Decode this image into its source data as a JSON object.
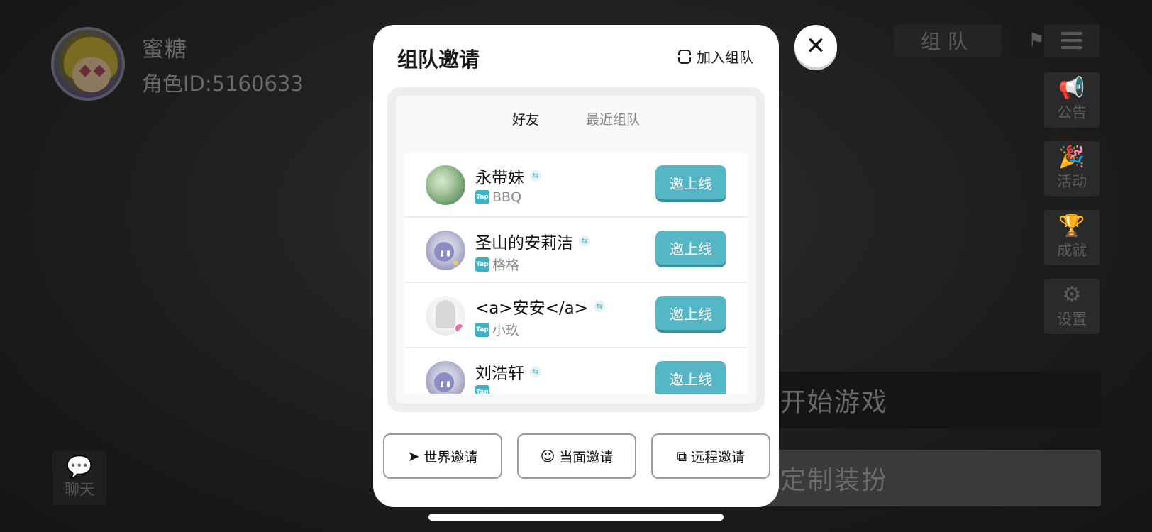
{
  "background": {
    "profile": {
      "name": "蜜糖",
      "role_id": "角色ID:5160633"
    },
    "team_tab": "组队",
    "side_menu": [
      {
        "icon": "megaphone-icon",
        "glyph": "📢",
        "label": "公告"
      },
      {
        "icon": "party-popper-icon",
        "glyph": "🎉",
        "label": "活动"
      },
      {
        "icon": "trophy-icon",
        "glyph": "🏆",
        "label": "成就"
      },
      {
        "icon": "gear-icon",
        "glyph": "⚙",
        "label": "设置"
      }
    ],
    "start_game": "开始游戏",
    "customize": "定制装扮",
    "chat": "聊天"
  },
  "modal": {
    "title": "组队邀请",
    "join_team": "加入组队",
    "tabs": [
      {
        "label": "好友",
        "active": true
      },
      {
        "label": "最近组队",
        "active": false
      }
    ],
    "friends": [
      {
        "name": "永带妹",
        "platform": "Tap",
        "nickname": "BBQ",
        "invite": "邀上线",
        "avatar": "green-photo"
      },
      {
        "name": "圣山的安莉洁",
        "platform": "Tap",
        "nickname": "格格",
        "invite": "邀上线",
        "avatar": "robot"
      },
      {
        "name": "<a>安安</a>",
        "platform": "Tap",
        "nickname": "小玖",
        "invite": "邀上线",
        "avatar": "sketch-girl"
      },
      {
        "name": "刘浩轩",
        "platform": "Tap",
        "nickname": "",
        "invite": "邀上线",
        "avatar": "robot"
      }
    ],
    "actions": [
      {
        "label": "世界邀请",
        "icon": "send-icon",
        "glyph": "➤"
      },
      {
        "label": "当面邀请",
        "icon": "face-icon",
        "glyph": "☺"
      },
      {
        "label": "远程邀请",
        "icon": "external-link-icon",
        "glyph": "⧉"
      }
    ]
  },
  "colors": {
    "invite_button": "#56b6c6",
    "tap_badge": "#3db3c8"
  }
}
